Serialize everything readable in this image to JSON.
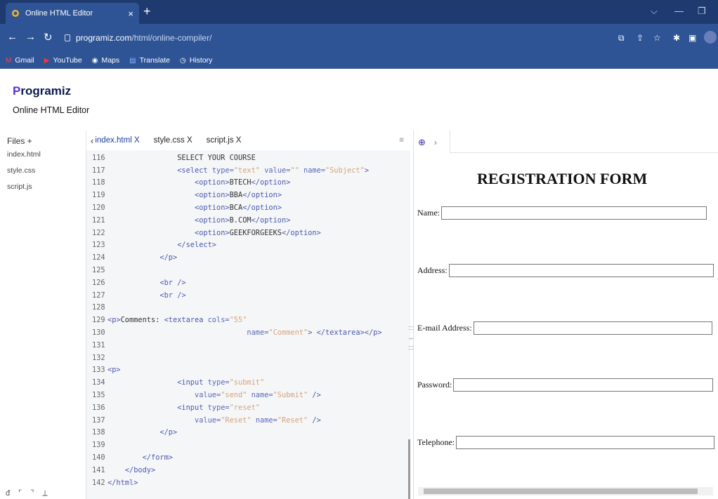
{
  "browser": {
    "tab_title": "Online HTML Editor",
    "tab_close": "×",
    "new_tab": "+",
    "url_host": "programiz.com",
    "url_path": "/html/online-compiler/",
    "bookmarks": [
      "Gmail",
      "YouTube",
      "Maps",
      "Translate",
      "History"
    ]
  },
  "site": {
    "brand_first": "P",
    "brand_rest": "rogramiz",
    "subtitle": "Online HTML Editor"
  },
  "files": {
    "header": "Files +",
    "items": [
      "index.html",
      "style.css",
      "script.js"
    ]
  },
  "editor": {
    "tabs": [
      "index.html",
      "style.css",
      "script.js"
    ],
    "close": "X",
    "lines": [
      {
        "n": "116",
        "html": "                SELECT YOUR COURSE"
      },
      {
        "n": "117",
        "html": "                <span class=\"tag\">&lt;select</span> <span class=\"attr\">type=</span><span class=\"val\">\"text\"</span> <span class=\"attr\">value=</span><span class=\"val\">\"\"</span> <span class=\"attr\">name=</span><span class=\"val\">\"Subject\"</span><span class=\"tag\">&gt;</span>"
      },
      {
        "n": "118",
        "html": "                    <span class=\"tag\">&lt;option&gt;</span>BTECH<span class=\"tag\">&lt;/option&gt;</span>"
      },
      {
        "n": "119",
        "html": "                    <span class=\"tag\">&lt;option&gt;</span>BBA<span class=\"tag\">&lt;/option&gt;</span>"
      },
      {
        "n": "120",
        "html": "                    <span class=\"tag\">&lt;option&gt;</span>BCA<span class=\"tag\">&lt;/option&gt;</span>"
      },
      {
        "n": "121",
        "html": "                    <span class=\"tag\">&lt;option&gt;</span>B.COM<span class=\"tag\">&lt;/option&gt;</span>"
      },
      {
        "n": "122",
        "html": "                    <span class=\"tag\">&lt;option&gt;</span>GEEKFORGEEKS<span class=\"tag\">&lt;/option&gt;</span>"
      },
      {
        "n": "123",
        "html": "                <span class=\"tag\">&lt;/select&gt;</span>"
      },
      {
        "n": "124",
        "html": "            <span class=\"tag\">&lt;/p&gt;</span>"
      },
      {
        "n": "125",
        "html": ""
      },
      {
        "n": "126",
        "html": "            <span class=\"tag\">&lt;br /&gt;</span>"
      },
      {
        "n": "127",
        "html": "            <span class=\"tag\">&lt;br /&gt;</span>"
      },
      {
        "n": "128",
        "html": ""
      },
      {
        "n": "129",
        "html": "<span class=\"tag\">&lt;p&gt;</span>Comments: <span class=\"tag\">&lt;textarea</span> <span class=\"attr\">cols=</span><span class=\"val\">\"55\"</span>"
      },
      {
        "n": "130",
        "html": "                                <span class=\"attr\">name=</span><span class=\"val\">\"Comment\"</span><span class=\"tag\">&gt; &lt;/textarea&gt;&lt;/p&gt;</span>"
      },
      {
        "n": "131",
        "html": ""
      },
      {
        "n": "132",
        "html": ""
      },
      {
        "n": "133",
        "html": "<span class=\"tag\">&lt;p&gt;</span>"
      },
      {
        "n": "134",
        "html": "                <span class=\"tag\">&lt;input</span> <span class=\"attr\">type=</span><span class=\"val\">\"submit\"</span>"
      },
      {
        "n": "135",
        "html": "                    <span class=\"attr\">value=</span><span class=\"val\">\"send\"</span> <span class=\"attr\">name=</span><span class=\"val\">\"Submit\"</span> <span class=\"tag\">/&gt;</span>"
      },
      {
        "n": "136",
        "html": "                <span class=\"tag\">&lt;input</span> <span class=\"attr\">type=</span><span class=\"val\">\"reset\"</span>"
      },
      {
        "n": "137",
        "html": "                    <span class=\"attr\">value=</span><span class=\"val\">\"Reset\"</span> <span class=\"attr\">name=</span><span class=\"val\">\"Reset\"</span> <span class=\"tag\">/&gt;</span>"
      },
      {
        "n": "138",
        "html": "            <span class=\"tag\">&lt;/p&gt;</span>"
      },
      {
        "n": "139",
        "html": ""
      },
      {
        "n": "140",
        "html": "        <span class=\"tag\">&lt;/form&gt;</span>"
      },
      {
        "n": "141",
        "html": "    <span class=\"tag\">&lt;/body&gt;</span>"
      },
      {
        "n": "142",
        "html": "<span class=\"tag\">&lt;/html&gt;</span>"
      }
    ]
  },
  "preview": {
    "title": "REGISTRATION FORM",
    "fields": [
      {
        "label": "Name:"
      },
      {
        "label": "Address:"
      },
      {
        "label": "E-mail Address:"
      },
      {
        "label": "Password:"
      },
      {
        "label": "Telephone:"
      }
    ]
  }
}
